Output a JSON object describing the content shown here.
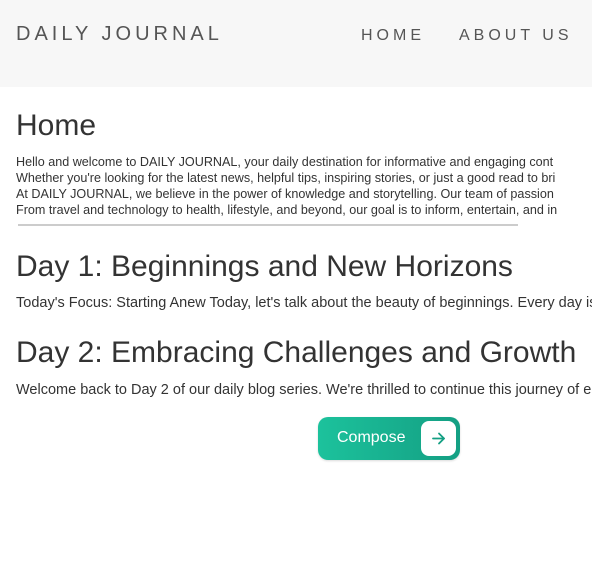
{
  "navbar": {
    "brand": "DAILY JOURNAL",
    "links": [
      "HOME",
      "ABOUT US"
    ]
  },
  "main": {
    "title": "Home",
    "intro": [
      "Hello and welcome to DAILY JOURNAL, your daily destination for informative and engaging cont",
      "Whether you're looking for the latest news, helpful tips, inspiring stories, or just a good read to bri",
      "At DAILY JOURNAL, we believe in the power of knowledge and storytelling. Our team of passion",
      "From travel and technology to health, lifestyle, and beyond, our goal is to inform, entertain, and in"
    ],
    "posts": [
      {
        "title": "Day 1: Beginnings and New Horizons",
        "excerpt": "Today's Focus: Starting Anew Today, let's talk about the beauty of beginnings. Every day is"
      },
      {
        "title": "Day 2: Embracing Challenges and Growth",
        "excerpt": "Welcome back to Day 2 of our daily blog series. We're thrilled to continue this journey of e"
      }
    ],
    "compose": {
      "label": "Compose",
      "icon": "arrow-right-icon"
    }
  },
  "colors": {
    "navbar_bg": "#f7f7f7",
    "button_gradient_start": "#1cc29c",
    "button_gradient_end": "#149f83",
    "text": "#333333"
  }
}
